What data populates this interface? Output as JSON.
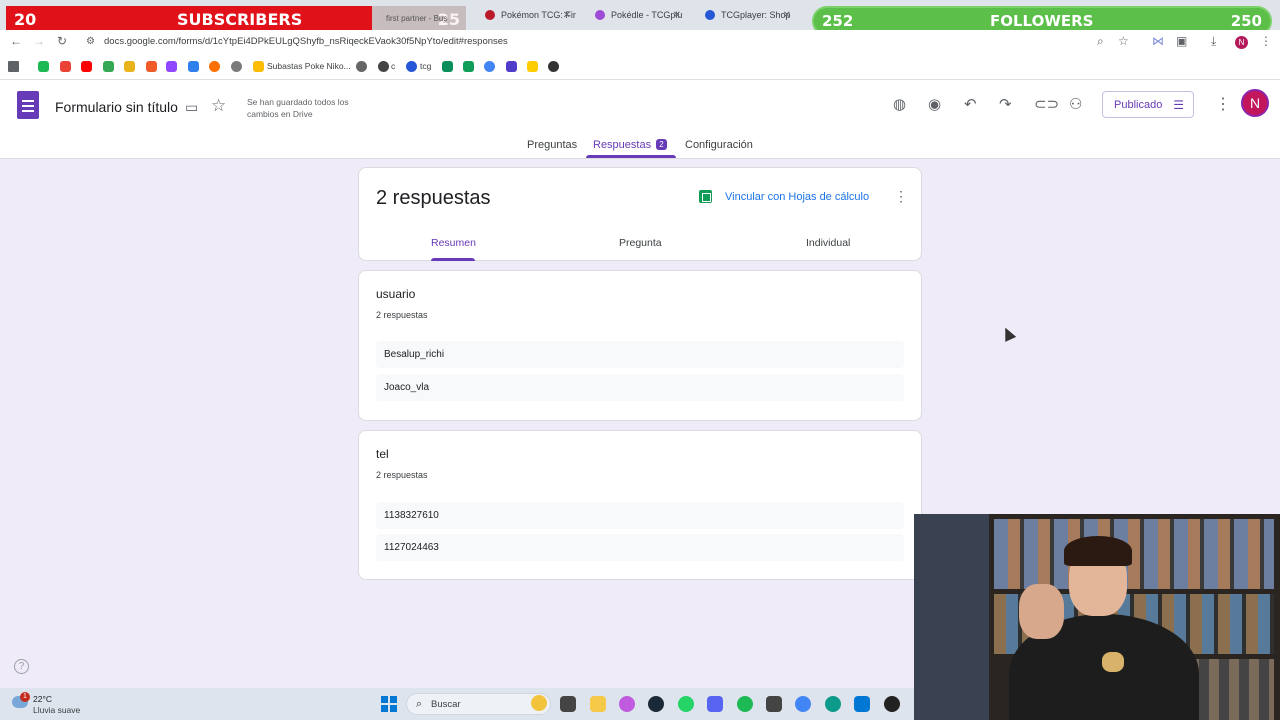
{
  "overlay": {
    "subscribers": {
      "count": "20",
      "label": "SUBSCRIBERS",
      "goal": "25"
    },
    "followers": {
      "count": "252",
      "label": "FOLLOWERS",
      "goal": "250"
    }
  },
  "browser": {
    "tabs": [
      {
        "title": "first partner - Bus",
        "close": "✕",
        "color": "#999999"
      },
      {
        "title": "Pokémon TCG: Fir",
        "close": "✕",
        "color": "#ba1b2b"
      },
      {
        "title": "Pokédle - TCGplu",
        "close": "✕",
        "color": "#a04bd6"
      },
      {
        "title": "TCGplayer: Shop",
        "close": "✕",
        "color": "#2557d6"
      }
    ],
    "url": "docs.google.com/forms/d/1cYtpEi4DPkEULgQShyfb_nsRiqeckEVaok30f5NpYto/edit#responses",
    "profile_initial": "N",
    "bookmarks": [
      {
        "label": "",
        "color": "#1db954"
      },
      {
        "label": "",
        "color": "#ea4335"
      },
      {
        "label": "",
        "color": "#ff0000"
      },
      {
        "label": "",
        "color": "#34a853"
      },
      {
        "label": "",
        "color": "#e8b31b"
      },
      {
        "label": "",
        "color": "#f05a28"
      },
      {
        "label": "",
        "color": "#9146ff"
      },
      {
        "label": "",
        "color": "#2f80ed"
      },
      {
        "label": "",
        "color": "#ff6f00"
      },
      {
        "label": "",
        "color": "#7a7a7a"
      },
      {
        "label": "Subastas Poke Niko...",
        "color": "#fbbc04"
      },
      {
        "label": "",
        "color": "#666666"
      },
      {
        "label": "c",
        "color": "#444444"
      },
      {
        "label": "tcg",
        "color": "#2557d6"
      },
      {
        "label": "",
        "color": "#0a8f5a"
      },
      {
        "label": "",
        "color": "#0f9d58"
      },
      {
        "label": "",
        "color": "#4285f4"
      },
      {
        "label": "",
        "color": "#4f3cc9"
      },
      {
        "label": "",
        "color": "#ffcc00"
      },
      {
        "label": "",
        "color": "#333333"
      }
    ]
  },
  "forms": {
    "title": "Formulario sin título",
    "save_status": "Se han guardado todos los cambios en Drive",
    "publish_label": "Publicado",
    "avatar_initial": "N",
    "tabs": {
      "preguntas": "Preguntas",
      "respuestas": "Respuestas",
      "respuestas_badge": "2",
      "configuracion": "Configuración"
    },
    "summary": {
      "count_label": "2 respuestas",
      "link_sheets": "Vincular con Hojas de cálculo",
      "subtabs": [
        "Resumen",
        "Pregunta",
        "Individual"
      ]
    },
    "questions": [
      {
        "title": "usuario",
        "count": "2 respuestas",
        "answers": [
          "Besalup_richi",
          "Joaco_vla"
        ]
      },
      {
        "title": "tel",
        "count": "2 respuestas",
        "answers": [
          "1138327610",
          "1127024463"
        ]
      }
    ]
  },
  "taskbar": {
    "weather": {
      "temp": "22°C",
      "desc": "Lluvia suave",
      "badge": "1"
    },
    "search_placeholder": "Buscar",
    "apps": [
      {
        "name": "widgets",
        "color": "#3aa0e0"
      },
      {
        "name": "terminal",
        "color": "#444444"
      },
      {
        "name": "explorer",
        "color": "#f7c948"
      },
      {
        "name": "copilot",
        "color": "#c05be0"
      },
      {
        "name": "steam",
        "color": "#1b2838"
      },
      {
        "name": "whatsapp",
        "color": "#25d366"
      },
      {
        "name": "discord",
        "color": "#5865f2"
      },
      {
        "name": "spotify",
        "color": "#1db954"
      },
      {
        "name": "calculator",
        "color": "#444444"
      },
      {
        "name": "chrome",
        "color": "#4285f4"
      },
      {
        "name": "edge",
        "color": "#0c9b8a"
      },
      {
        "name": "photos",
        "color": "#0078d4"
      },
      {
        "name": "obs",
        "color": "#222222"
      }
    ]
  }
}
